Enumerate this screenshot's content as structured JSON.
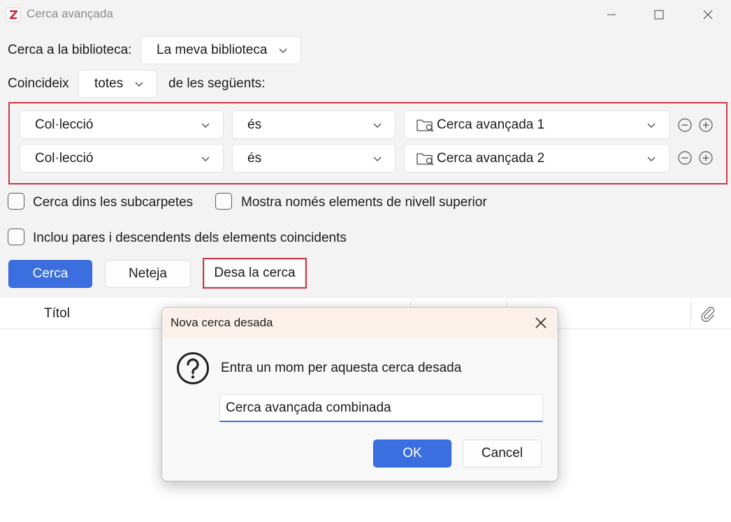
{
  "window": {
    "title": "Cerca avançada"
  },
  "search": {
    "library_label": "Cerca a la biblioteca:",
    "library_value": "La meva biblioteca",
    "match_label": "Coincideix",
    "match_value": "totes",
    "match_suffix": "de les següents:"
  },
  "conditions": [
    {
      "field": "Col·lecció",
      "operator": "és",
      "value": "Cerca avançada 1"
    },
    {
      "field": "Col·lecció",
      "operator": "és",
      "value": "Cerca avançada 2"
    }
  ],
  "options": {
    "subfolders": "Cerca dins les subcarpetes",
    "top_level": "Mostra només elements de nivell superior",
    "include_parents": "Inclou pares i descendents dels elements coincidents"
  },
  "buttons": {
    "search": "Cerca",
    "clear": "Neteja",
    "save": "Desa la cerca"
  },
  "table": {
    "title_column": "Títol"
  },
  "dialog": {
    "title": "Nova cerca desada",
    "message": "Entra un mom per aquesta cerca desada",
    "input_value": "Cerca avançada combinada",
    "ok": "OK",
    "cancel": "Cancel"
  },
  "colors": {
    "accent": "#3b6fe0",
    "highlight": "#c9394a"
  },
  "icons": {
    "app": "zotero-icon",
    "saved_search": "saved-search-folder-icon",
    "question": "question-icon",
    "attachment": "paperclip-icon"
  }
}
